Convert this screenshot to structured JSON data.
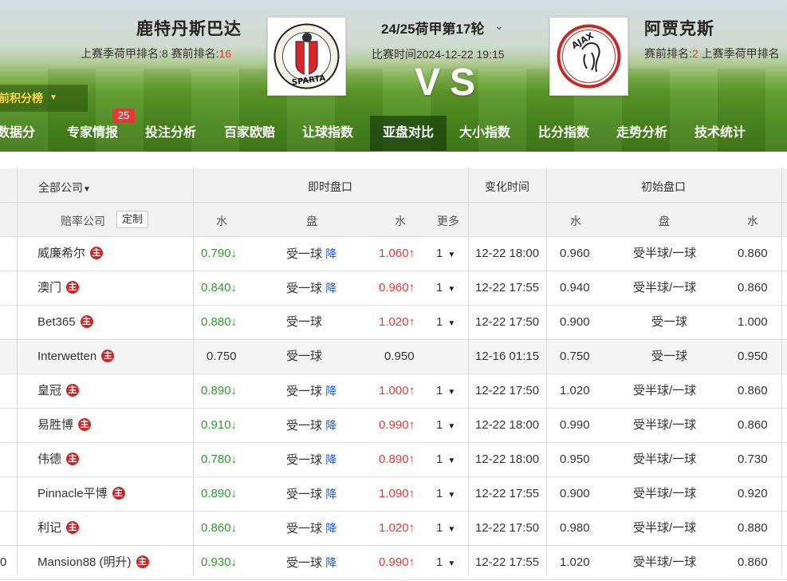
{
  "home": {
    "name": "鹿特丹斯巴达",
    "meta_prefix": "上赛季荷甲排名:8   赛前排名:",
    "rank": "16"
  },
  "away": {
    "name": "阿贾克斯",
    "meta_prefix": "赛前排名:",
    "rank": "2",
    "meta_suffix": "   上赛季荷甲排名"
  },
  "match": {
    "round": "24/25荷甲第17轮",
    "time": "比赛时间2024-12-22 19:15",
    "vs": "VS"
  },
  "home_logo_text": "SPARTA",
  "away_logo_text": "AJAX",
  "rank_dropdown": "前积分榜",
  "nav": {
    "badge": "25",
    "tabs": [
      "数据分析",
      "专家情报",
      "投注分析",
      "百家欧赔",
      "让球指数",
      "亚盘对比",
      "大小指数",
      "比分指数",
      "走势分析",
      "技术统计"
    ],
    "active": "亚盘对比"
  },
  "table": {
    "company_filter": "全部公司",
    "group_live": "即时盘口",
    "group_change": "变化时间",
    "group_initial": "初始盘口",
    "col_company": "赔率公司",
    "custom_btn": "定制",
    "col_water": "水",
    "col_pan": "盘",
    "col_more": "更多",
    "host_mark": "主",
    "rows": [
      {
        "company": "威廉希尔",
        "w1": "0.790",
        "w1_dir": "↓",
        "pan": "受一球",
        "pan_change": "降",
        "w2": "1.060",
        "w2_dir": "↑",
        "more": "1",
        "time": "12-22 18:00",
        "iw1": "0.960",
        "ipan": "受半球/一球",
        "iw2": "0.860"
      },
      {
        "company": "澳门",
        "w1": "0.840",
        "w1_dir": "↓",
        "pan": "受一球",
        "pan_change": "降",
        "w2": "0.960",
        "w2_dir": "↑",
        "more": "1",
        "time": "12-22 17:55",
        "iw1": "0.940",
        "ipan": "受半球/一球",
        "iw2": "0.860"
      },
      {
        "company": "Bet365",
        "w1": "0.880",
        "w1_dir": "↓",
        "pan": "受一球",
        "pan_change": "",
        "w2": "1.020",
        "w2_dir": "↑",
        "more": "1",
        "time": "12-22 17:50",
        "iw1": "0.900",
        "ipan": "受一球",
        "iw2": "1.000"
      },
      {
        "company": "Interwetten",
        "w1": "0.750",
        "w1_dir": "",
        "pan": "受一球",
        "pan_change": "",
        "w2": "0.950",
        "w2_dir": "",
        "more": "",
        "time": "12-16 01:15",
        "iw1": "0.750",
        "ipan": "受一球",
        "iw2": "0.950"
      },
      {
        "company": "皇冠",
        "w1": "0.890",
        "w1_dir": "↓",
        "pan": "受一球",
        "pan_change": "降",
        "w2": "1.000",
        "w2_dir": "↑",
        "more": "1",
        "time": "12-22 17:50",
        "iw1": "1.020",
        "ipan": "受半球/一球",
        "iw2": "0.860"
      },
      {
        "company": "易胜博",
        "w1": "0.910",
        "w1_dir": "↓",
        "pan": "受一球",
        "pan_change": "降",
        "w2": "0.990",
        "w2_dir": "↑",
        "more": "1",
        "time": "12-22 18:00",
        "iw1": "0.990",
        "ipan": "受半球/一球",
        "iw2": "0.860"
      },
      {
        "company": "伟德",
        "w1": "0.780",
        "w1_dir": "↓",
        "pan": "受一球",
        "pan_change": "降",
        "w2": "0.890",
        "w2_dir": "↑",
        "more": "1",
        "time": "12-22 18:00",
        "iw1": "0.950",
        "ipan": "受半球/一球",
        "iw2": "0.730"
      },
      {
        "company": "Pinnacle平博",
        "w1": "0.890",
        "w1_dir": "↓",
        "pan": "受一球",
        "pan_change": "降",
        "w2": "1.090",
        "w2_dir": "↑",
        "more": "1",
        "time": "12-22 17:55",
        "iw1": "0.900",
        "ipan": "受半球/一球",
        "iw2": "0.920"
      },
      {
        "company": "利记",
        "w1": "0.860",
        "w1_dir": "↓",
        "pan": "受一球",
        "pan_change": "降",
        "w2": "1.020",
        "w2_dir": "↑",
        "more": "1",
        "time": "12-22 17:50",
        "iw1": "0.980",
        "ipan": "受半球/一球",
        "iw2": "0.880"
      },
      {
        "company": "Mansion88 (明升)",
        "w1": "0.930",
        "w1_dir": "↓",
        "pan": "受一球",
        "pan_change": "降",
        "w2": "0.990",
        "w2_dir": "↑",
        "more": "1",
        "time": "12-22 17:55",
        "iw1": "1.020",
        "ipan": "受半球/一球",
        "iw2": "0.860"
      }
    ],
    "last_row_left_fragment": "0"
  },
  "colors": {
    "up": "#e53935",
    "down": "#2e9c2e",
    "pan_change": "#1a56d6",
    "host_badge": "#c62828",
    "rank_highlight": "#e53935"
  }
}
